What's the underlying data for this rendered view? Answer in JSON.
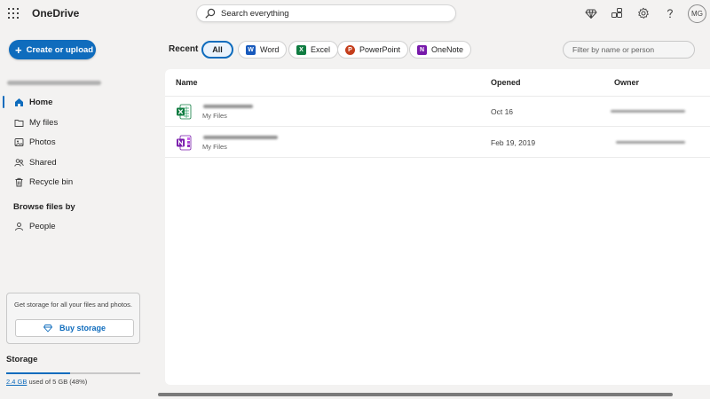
{
  "app": {
    "title": "OneDrive"
  },
  "search": {
    "placeholder": "Search everything"
  },
  "toolbar": {
    "icons": [
      "diamond-icon",
      "share-icon",
      "gear-icon",
      "help-icon"
    ],
    "avatar_initials": "MG"
  },
  "sidebar": {
    "create_label": "Create or upload",
    "items": [
      {
        "label": "Home",
        "icon": "home-icon",
        "active": true
      },
      {
        "label": "My files",
        "icon": "folder-icon"
      },
      {
        "label": "Photos",
        "icon": "photo-icon"
      },
      {
        "label": "Shared",
        "icon": "people-icon"
      },
      {
        "label": "Recycle bin",
        "icon": "trash-icon"
      }
    ],
    "browse_heading": "Browse files by",
    "browse_items": [
      {
        "label": "People",
        "icon": "person-icon"
      }
    ],
    "storage_card": {
      "message": "Get storage for all your files and photos.",
      "buy_label": "Buy storage"
    },
    "storage": {
      "heading": "Storage",
      "used": "2.4 GB",
      "detail": " used of 5 GB (48%)",
      "fraction": 0.48
    }
  },
  "filters": {
    "recent_label": "Recent",
    "chips": [
      "All",
      "Word",
      "Excel",
      "PowerPoint",
      "OneNote"
    ],
    "selected": "All",
    "filter_placeholder": "Filter by name or person"
  },
  "colors": {
    "accent": "#0f6cbd",
    "word": "#185abd",
    "excel": "#107c41",
    "powerpoint": "#c43e1c",
    "onenote": "#7719aa"
  },
  "table": {
    "columns": [
      "Name",
      "Opened",
      "Owner"
    ],
    "rows": [
      {
        "type": "excel",
        "location": "My Files",
        "opened": "Oct 16"
      },
      {
        "type": "onenote",
        "location": "My Files",
        "opened": "Feb 19, 2019"
      }
    ]
  }
}
